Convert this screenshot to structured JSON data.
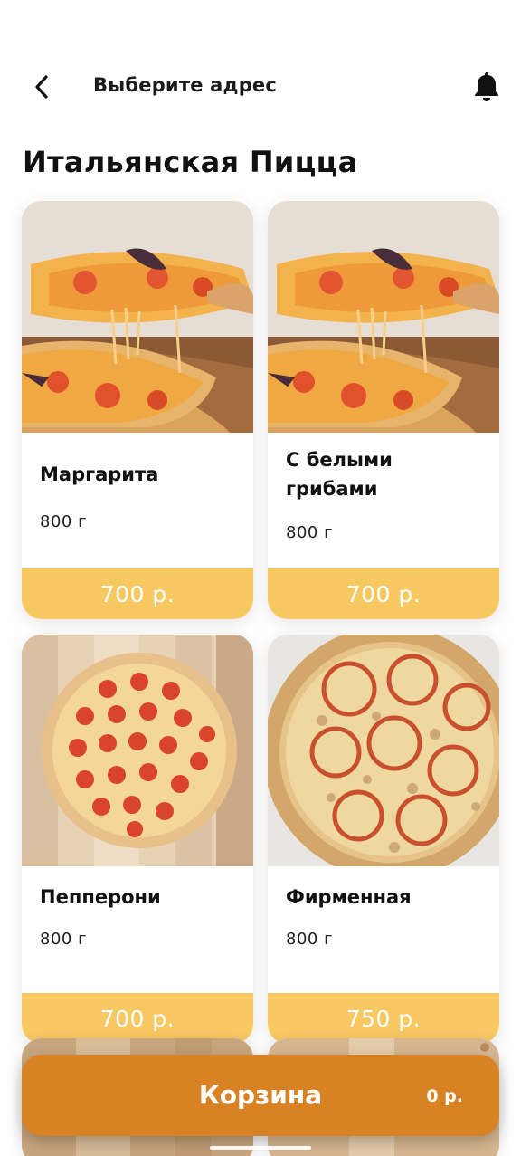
{
  "header": {
    "address_label": "Выберите адрес"
  },
  "page": {
    "title": "Итальянская Пицца"
  },
  "products": [
    {
      "name": "Маргарита",
      "weight": "800 г",
      "price": "700 р.",
      "image": "cheese-pull-pizza"
    },
    {
      "name": "С белыми грибами",
      "weight": "800 г",
      "price": "700 р.",
      "image": "cheese-pull-pizza"
    },
    {
      "name": "Пепперони",
      "weight": "800 г",
      "price": "700 р.",
      "image": "pepperoni-pizza"
    },
    {
      "name": "Фирменная",
      "weight": "800 г",
      "price": "750 р.",
      "image": "tomato-pizza"
    }
  ],
  "cart": {
    "label": "Корзина",
    "total": "0 р."
  },
  "colors": {
    "price_bar": "#f8c862",
    "cart_bar": "#d98224"
  },
  "icons": [
    "chevron-left-icon",
    "bell-icon"
  ]
}
